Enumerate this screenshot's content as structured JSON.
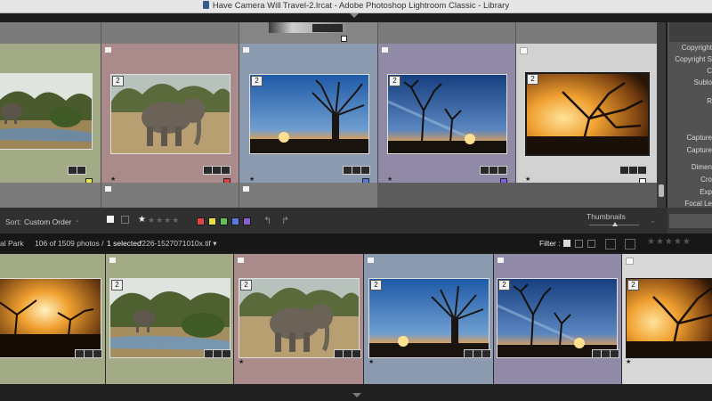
{
  "window": {
    "title": "Have Camera Will Travel-2.lrcat - Adobe Photoshop Lightroom Classic - Library"
  },
  "grid": {
    "cells": [
      {
        "badge": "2",
        "bg": "#a3ab86",
        "label_color": "#e6e640",
        "image": "elephants-wide"
      },
      {
        "badge": "2",
        "bg": "#aa8a8a",
        "label_color": "#e04040",
        "image": "elephant-close"
      },
      {
        "badge": "2",
        "bg": "#8c9ab0",
        "label_color": "#5b78e0",
        "image": "baobab-sunset"
      },
      {
        "badge": "2",
        "bg": "#918aa7",
        "label_color": "#8060e0",
        "image": "acacia-blue"
      },
      {
        "badge": "2",
        "bg": "#d2d2d2",
        "label_color": "#ffffff",
        "image": "golden-tree"
      }
    ]
  },
  "right_panel": {
    "labels": [
      "Copyright",
      "Copyright S",
      "C",
      "Sublo",
      "R",
      "Capture",
      "Capture",
      "Dimen",
      "Cro",
      "Exp",
      "Focal Le"
    ]
  },
  "toolbar": {
    "sort_label": "Sort:",
    "sort_value": "Custom Order",
    "thumbnails_label": "Thumbnails",
    "color_labels": [
      "#e04444",
      "#e6e040",
      "#60c060",
      "#5b78e0",
      "#8a60d0"
    ]
  },
  "filmstrip_header": {
    "folder": "al Park",
    "count": "106 of 1509 photos /",
    "selected": "1 selected",
    "filename": "/226-1527071010x.tif ▾",
    "filter_label": "Filter :"
  },
  "filmstrip": {
    "cells": [
      {
        "badge": "",
        "bg": "#a3ab86",
        "image": "sunset-trees"
      },
      {
        "badge": "2",
        "bg": "#a3ab86",
        "image": "elephants-wide"
      },
      {
        "badge": "2",
        "bg": "#aa8a8a",
        "image": "elephant-close"
      },
      {
        "badge": "2",
        "bg": "#8c9ab0",
        "image": "baobab-sunset"
      },
      {
        "badge": "2",
        "bg": "#918aa7",
        "image": "acacia-blue"
      },
      {
        "badge": "2",
        "bg": "#d8d8d8",
        "image": "golden-tree"
      }
    ]
  }
}
